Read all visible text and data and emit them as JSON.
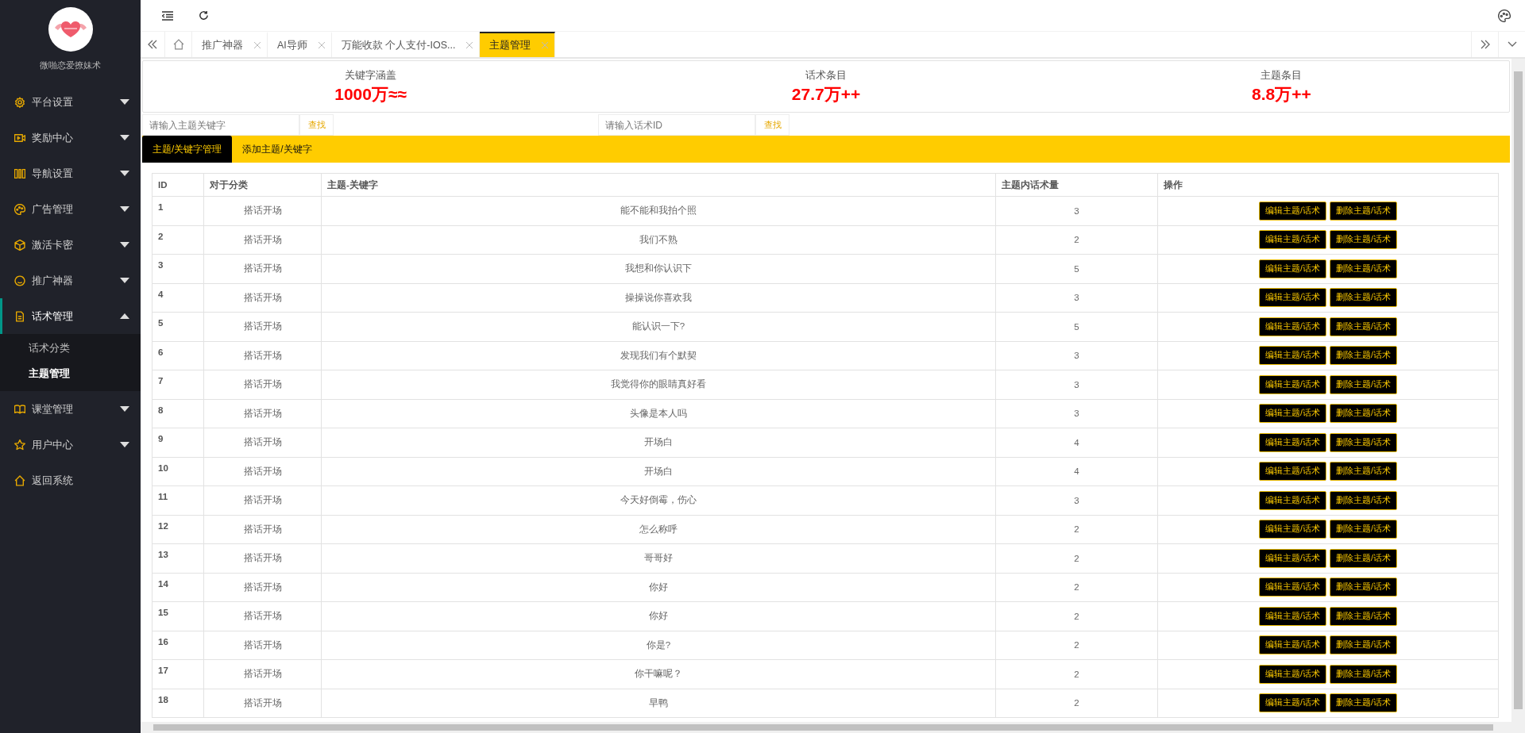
{
  "sidebar": {
    "brand": "微啪恋爱撩妹术",
    "items": [
      {
        "label": "平台设置",
        "kind": "group",
        "expanded": false,
        "selected": false
      },
      {
        "label": "奖励中心",
        "kind": "group",
        "expanded": false,
        "selected": false
      },
      {
        "label": "导航设置",
        "kind": "group",
        "expanded": false,
        "selected": false
      },
      {
        "label": "广告管理",
        "kind": "group",
        "expanded": false,
        "selected": false
      },
      {
        "label": "激活卡密",
        "kind": "group",
        "expanded": false,
        "selected": false
      },
      {
        "label": "推广神器",
        "kind": "group",
        "expanded": false,
        "selected": false
      },
      {
        "label": "话术管理",
        "kind": "group",
        "expanded": true,
        "selected": true,
        "children": [
          {
            "label": "话术分类",
            "selected": false
          },
          {
            "label": "主题管理",
            "selected": true
          }
        ]
      },
      {
        "label": "课堂管理",
        "kind": "group",
        "expanded": false,
        "selected": false
      },
      {
        "label": "用户中心",
        "kind": "group",
        "expanded": false,
        "selected": false
      },
      {
        "label": "返回系统",
        "kind": "link",
        "selected": false
      }
    ]
  },
  "tabs": [
    {
      "label": "推广神器",
      "selected": false
    },
    {
      "label": "AI导师",
      "selected": false
    },
    {
      "label": "万能收款 个人支付-IOS...",
      "selected": false
    },
    {
      "label": "主题管理",
      "selected": true
    }
  ],
  "stats": [
    {
      "label": "关键字涵盖",
      "value": "1000万≈≈"
    },
    {
      "label": "话术条目",
      "value": "27.7万++"
    },
    {
      "label": "主题条目",
      "value": "8.8万++"
    }
  ],
  "searches": [
    {
      "placeholder": "请输入主题关键字",
      "button": "查找"
    },
    {
      "placeholder": "请输入话术ID",
      "button": "查找"
    }
  ],
  "subtabs": [
    {
      "label": "主题/关键字管理",
      "selected": true
    },
    {
      "label": "添加主题/关键字",
      "selected": false
    }
  ],
  "table": {
    "columns": [
      "ID",
      "对于分类",
      "主题-关键字",
      "主题内话术量",
      "操作"
    ],
    "rows": [
      {
        "id": "1",
        "category": "搭话开场",
        "topic": "能不能和我拍个照",
        "count": "3",
        "actions": [
          "编辑主题/话术",
          "删除主题/话术"
        ]
      },
      {
        "id": "2",
        "category": "搭话开场",
        "topic": "我们不熟",
        "count": "2",
        "actions": [
          "编辑主题/话术",
          "删除主题/话术"
        ]
      },
      {
        "id": "3",
        "category": "搭话开场",
        "topic": "我想和你认识下",
        "count": "5",
        "actions": [
          "编辑主题/话术",
          "删除主题/话术"
        ]
      },
      {
        "id": "4",
        "category": "搭话开场",
        "topic": "操操说你喜欢我",
        "count": "3",
        "actions": [
          "编辑主题/话术",
          "删除主题/话术"
        ]
      },
      {
        "id": "5",
        "category": "搭话开场",
        "topic": "能认识一下?",
        "count": "5",
        "actions": [
          "编辑主题/话术",
          "删除主题/话术"
        ]
      },
      {
        "id": "6",
        "category": "搭话开场",
        "topic": "发现我们有个默契",
        "count": "3",
        "actions": [
          "编辑主题/话术",
          "删除主题/话术"
        ]
      },
      {
        "id": "7",
        "category": "搭话开场",
        "topic": "我觉得你的眼睛真好看",
        "count": "3",
        "actions": [
          "编辑主题/话术",
          "删除主题/话术"
        ]
      },
      {
        "id": "8",
        "category": "搭话开场",
        "topic": "头像是本人吗",
        "count": "3",
        "actions": [
          "编辑主题/话术",
          "删除主题/话术"
        ]
      },
      {
        "id": "9",
        "category": "搭话开场",
        "topic": "开场白",
        "count": "4",
        "actions": [
          "编辑主题/话术",
          "删除主题/话术"
        ]
      },
      {
        "id": "10",
        "category": "搭话开场",
        "topic": "开场白",
        "count": "4",
        "actions": [
          "编辑主题/话术",
          "删除主题/话术"
        ]
      },
      {
        "id": "11",
        "category": "搭话开场",
        "topic": "今天好倒霉，伤心",
        "count": "3",
        "actions": [
          "编辑主题/话术",
          "删除主题/话术"
        ]
      },
      {
        "id": "12",
        "category": "搭话开场",
        "topic": "怎么称呼",
        "count": "2",
        "actions": [
          "编辑主题/话术",
          "删除主题/话术"
        ]
      },
      {
        "id": "13",
        "category": "搭话开场",
        "topic": "哥哥好",
        "count": "2",
        "actions": [
          "编辑主题/话术",
          "删除主题/话术"
        ]
      },
      {
        "id": "14",
        "category": "搭话开场",
        "topic": "你好",
        "count": "2",
        "actions": [
          "编辑主题/话术",
          "删除主题/话术"
        ]
      },
      {
        "id": "15",
        "category": "搭话开场",
        "topic": "你好",
        "count": "2",
        "actions": [
          "编辑主题/话术",
          "删除主题/话术"
        ]
      },
      {
        "id": "16",
        "category": "搭话开场",
        "topic": "你是?",
        "count": "2",
        "actions": [
          "编辑主题/话术",
          "删除主题/话术"
        ]
      },
      {
        "id": "17",
        "category": "搭话开场",
        "topic": "你干嘛呢？",
        "count": "2",
        "actions": [
          "编辑主题/话术",
          "删除主题/话术"
        ]
      },
      {
        "id": "18",
        "category": "搭话开场",
        "topic": "早鸭",
        "count": "2",
        "actions": [
          "编辑主题/话术",
          "删除主题/话术"
        ]
      }
    ]
  }
}
